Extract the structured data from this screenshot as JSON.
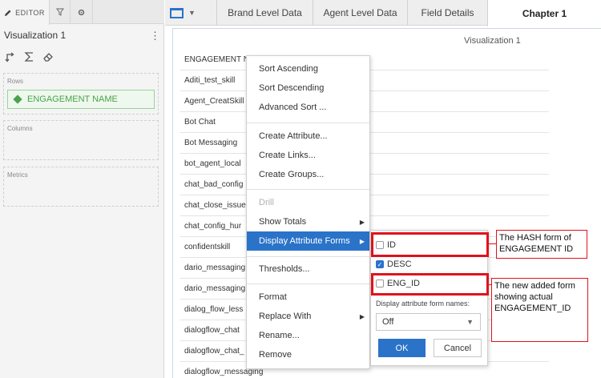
{
  "editor": {
    "tab_label": "EDITOR",
    "viz_name": "Visualization 1",
    "kebab": "⋮",
    "zones": {
      "rows_label": "Rows",
      "rows_item": "ENGAGEMENT NAME",
      "columns_label": "Columns",
      "metrics_label": "Metrics"
    }
  },
  "tabs": [
    "Brand Level Data",
    "Agent Level Data",
    "Field Details",
    "Chapter 1"
  ],
  "grid": {
    "title": "Visualization 1",
    "column_header": "ENGAGEMENT NAME",
    "rows": [
      "Aditi_test_skill",
      "Agent_CreatSkill",
      "Bot Chat",
      "Bot Messaging",
      "bot_agent_local",
      "chat_bad_config",
      "chat_close_issue",
      "chat_config_hur",
      "confidentskill",
      "dario_messaging",
      "dario_messaging",
      "dialog_flow_less",
      "dialogflow_chat",
      "dialogflow_chat_",
      "dialogflow_messaging"
    ]
  },
  "context_menu": {
    "items": [
      {
        "label": "Sort Ascending"
      },
      {
        "label": "Sort Descending"
      },
      {
        "label": "Advanced Sort ..."
      },
      {
        "label": "Create Attribute..."
      },
      {
        "label": "Create Links..."
      },
      {
        "label": "Create Groups..."
      },
      {
        "label": "Drill"
      },
      {
        "label": "Show Totals"
      },
      {
        "label": "Display Attribute Forms"
      },
      {
        "label": "Thresholds..."
      },
      {
        "label": "Format"
      },
      {
        "label": "Replace With"
      },
      {
        "label": "Rename..."
      },
      {
        "label": "Remove"
      }
    ]
  },
  "attribute_forms": {
    "options": [
      {
        "label": "ID",
        "checked": false
      },
      {
        "label": "DESC",
        "checked": true
      },
      {
        "label": "ENG_ID",
        "checked": false
      }
    ],
    "names_label": "Display attribute form names:",
    "names_value": "Off",
    "ok_label": "OK",
    "cancel_label": "Cancel"
  },
  "annotations": {
    "note1": "The HASH form of ENGAGEMENT ID",
    "note2": "The new added form showing actual ENGAGEMENT_ID"
  },
  "colors": {
    "accent": "#2a73c9",
    "annotation": "#e0121c",
    "attribute_green": "#4aa24a"
  }
}
